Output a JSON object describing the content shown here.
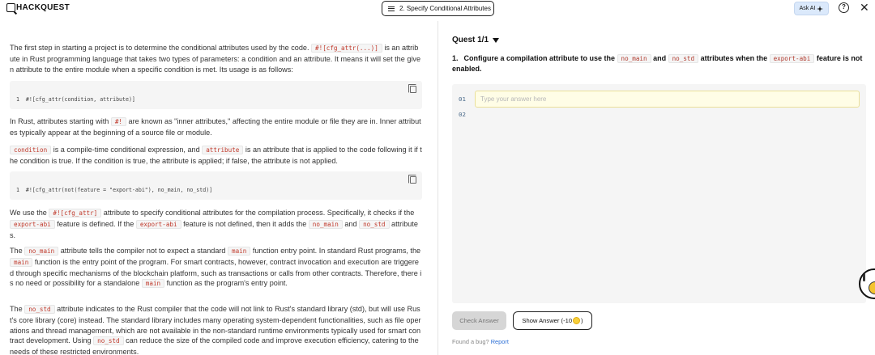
{
  "header": {
    "logo_text": "HACKQUEST",
    "task_title": "2. Specify Conditional Attributes",
    "ask_ai_label": "Ask AI",
    "help_symbol": "?",
    "close_symbol": "✕"
  },
  "lesson": {
    "p1": {
      "before": "The first step in starting a project is to determine the conditional attributes used by the code.",
      "code": "#![cfg_attr(...)]",
      "after": "is an attribute in Rust programming language that takes two types of parameters: a condition and an attribute. It means it will set the given attribute to the entire module when a specific condition is met. Its usage is as follows:"
    },
    "code_block_1": "1  #![cfg_attr(condition, attribute)]",
    "p2": {
      "before": "In Rust, attributes starting with",
      "code": "#!",
      "after": "are known as \"inner attributes,\" affecting the entire module or file they are in. Inner attributes typically appear at the beginning of a source file or module."
    },
    "p3": {
      "code1": "condition",
      "mid1": "is a compile-time conditional expression, and",
      "code2": "attribute",
      "after": "is an attribute that is applied to the code following it if the condition is true. If the condition is true, the attribute is applied; if false, the attribute is not applied."
    },
    "code_block_2": "1  #![cfg_attr(not(feature = \"export-abi\"), no_main, no_std)]",
    "p4": {
      "t1": "We use the",
      "c1": "#![cfg_attr]",
      "t2": "attribute to specify conditional attributes for the compilation process. Specifically, it checks if the",
      "c2": "export-abi",
      "t3": "feature is defined. If the",
      "c3": "export-abi",
      "t4": "feature is not defined, then it adds the",
      "c4": "no_main",
      "t5": "and",
      "c5": "no_std",
      "t6": "attributes."
    },
    "p5": {
      "t1": "The",
      "c1": "no_main",
      "t2": "attribute tells the compiler not to expect a standard",
      "c2": "main",
      "t3": "function entry point. In standard Rust programs, the",
      "c3": "main",
      "t4": "function is the entry point of the program. For smart contracts, however, contract invocation and execution are triggered through specific mechanisms of the blockchain platform, such as transactions or calls from other contracts. Therefore, there is no need or possibility for a standalone",
      "c4": "main",
      "t5": "function as the program's entry point."
    },
    "p6": {
      "t1": "The",
      "c1": "no_std",
      "t2": "attribute indicates to the Rust compiler that the code will not link to Rust's standard library (std), but will use Rust's core library (core) instead. The standard library includes many operating system-dependent functionalities, such as file operations and thread management, which are not available in the non-standard runtime environments typically used for smart contract development. Using",
      "c2": "no_std",
      "t3": "can reduce the size of the compiled code and improve execution efficiency, catering to the needs of these restricted environments."
    }
  },
  "quest": {
    "title": "Quest 1/1",
    "number": "1.",
    "q_t1": "Configure a compilation attribute to use the",
    "q_c1": "no_main",
    "q_t2": "and",
    "q_c2": "no_std",
    "q_t3": "attributes when the",
    "q_c3": "export-abi",
    "q_t4": "feature is not enabled.",
    "line_numbers": [
      "01",
      "02"
    ],
    "answer_placeholder": "Type your answer here",
    "answer_value": "",
    "check_label": "Check Answer",
    "show_label": "Show Answer (-10",
    "show_suffix": ")",
    "bug_text": "Found a bug?",
    "report_label": "Report"
  },
  "colors": {
    "inline_code": "#c0392b",
    "ask_ai_bg": "#dbe9fb",
    "input_bg": "#fffde6",
    "link": "#2c6fd6"
  },
  "icons": [
    "logo-mark-icon",
    "menu-icon",
    "sparkle-icon",
    "help-icon",
    "close-icon",
    "copy-icon",
    "dropdown-triangle-icon",
    "coin-icon",
    "mascot-icon"
  ]
}
